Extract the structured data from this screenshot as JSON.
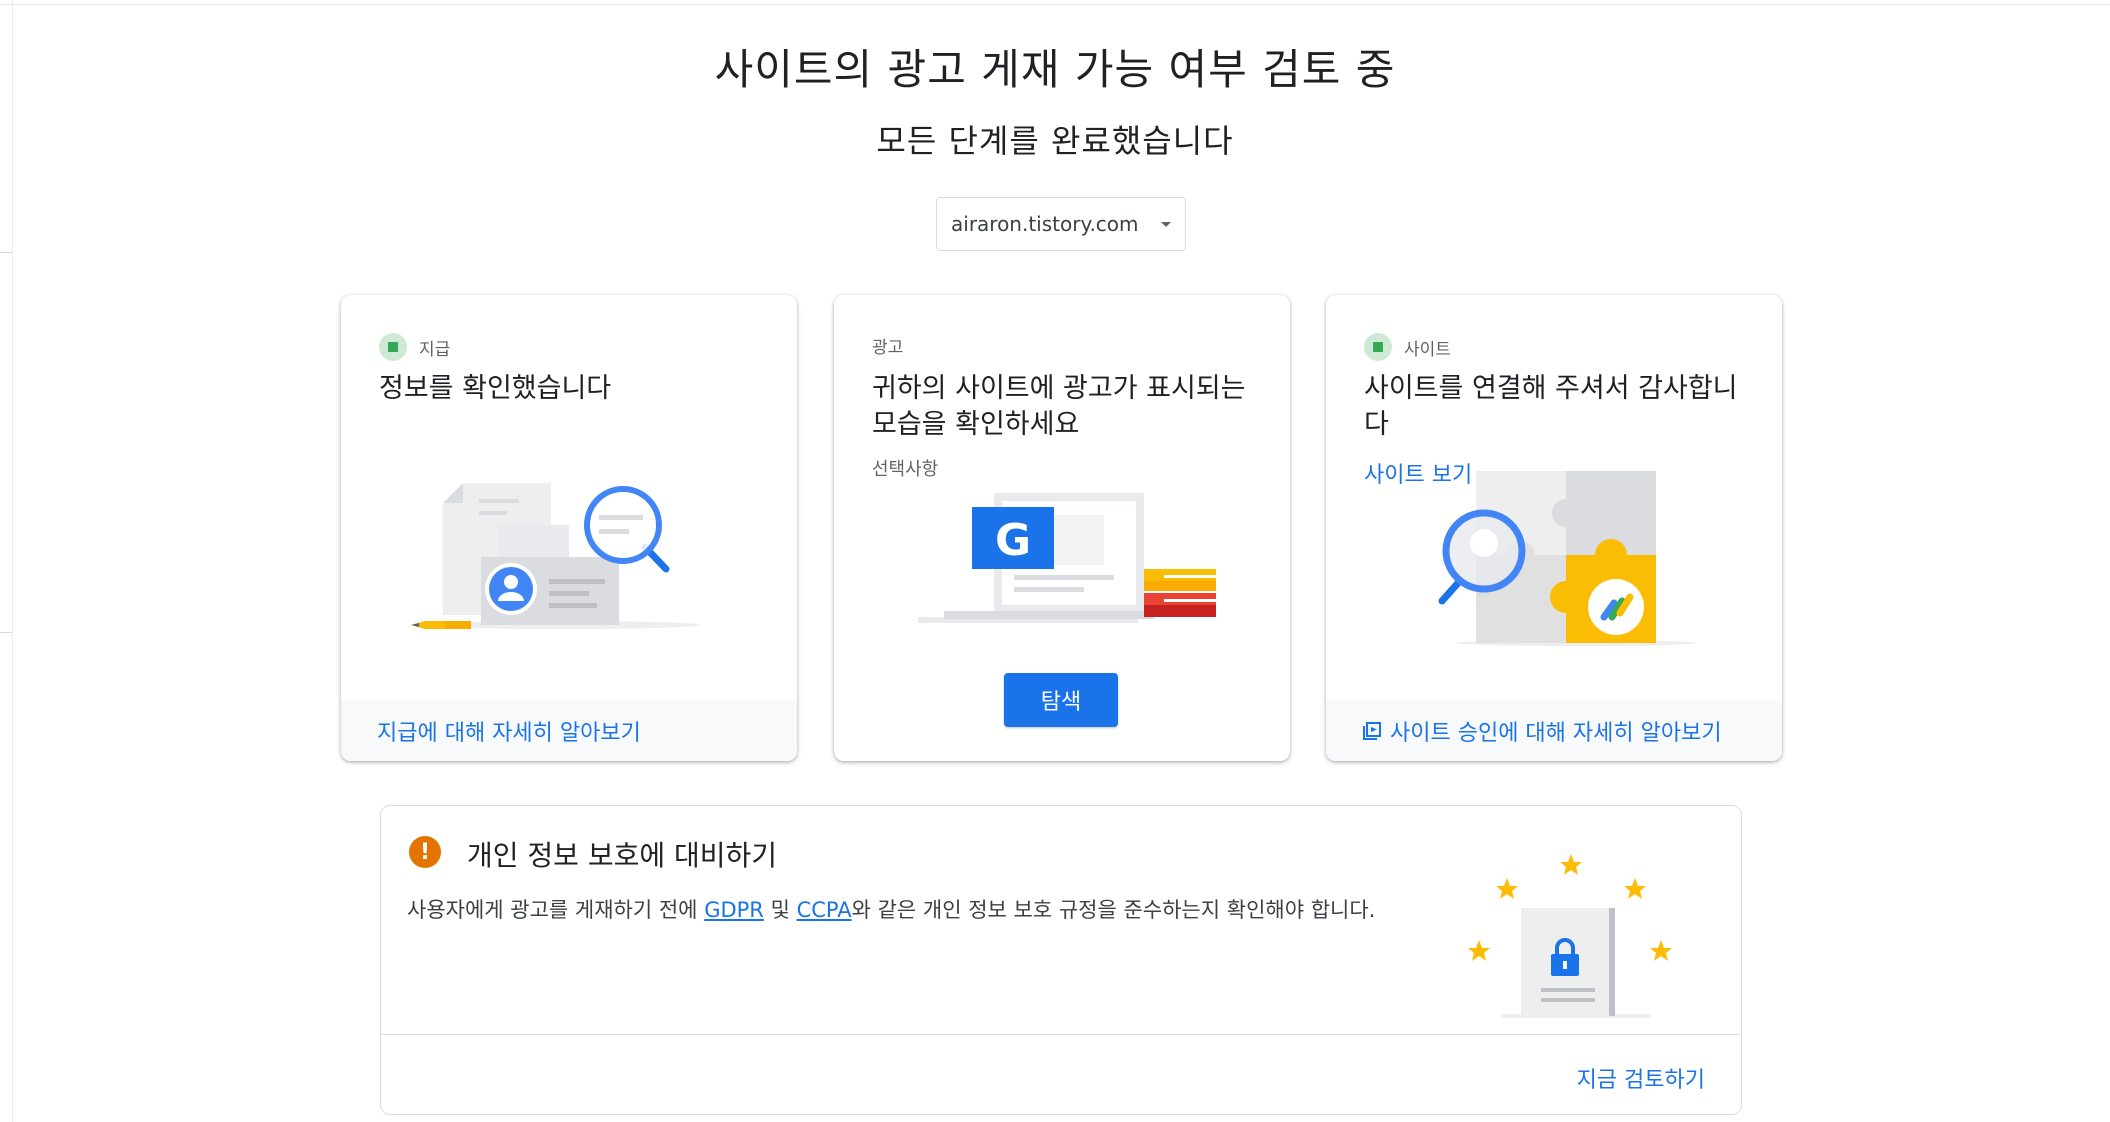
{
  "header": {
    "title": "사이트의 광고 게재 가능 여부 검토 중",
    "subtitle": "모든 단계를 완료했습니다"
  },
  "site_selector": {
    "value": "airaron.tistory.com",
    "icon": "caret-down-icon"
  },
  "cards": {
    "payments": {
      "tag": "지급",
      "status": "complete",
      "title": "정보를 확인했습니다",
      "footer_link": "지급에 대해 자세히 알아보기"
    },
    "ads": {
      "tag": "광고",
      "title": "귀하의 사이트에 광고가 표시되는 모습을 확인하세요",
      "optional_label": "선택사항",
      "button_label": "탐색"
    },
    "sites": {
      "tag": "사이트",
      "status": "complete",
      "title": "사이트를 연결해 주셔서 감사합니다",
      "link": "사이트 보기",
      "footer_link": "사이트 승인에 대해 자세히 알아보기",
      "footer_icon": "open-in-new-icon"
    }
  },
  "privacy": {
    "icon": "warning-icon",
    "title": "개인 정보 보호에 대비하기",
    "body_before": "사용자에게 광고를 게재하기 전에 ",
    "gdpr_link": "GDPR",
    "body_middle": " 및 ",
    "ccpa_link": "CCPA",
    "body_after": "와 같은 개인 정보 보호 규정을 준수하는지 확인해야 합니다.",
    "action": "지금 검토하기"
  },
  "colors": {
    "accent": "#1a73e8",
    "success": "#34a853",
    "warning": "#e37400",
    "star": "#fbbc04"
  }
}
